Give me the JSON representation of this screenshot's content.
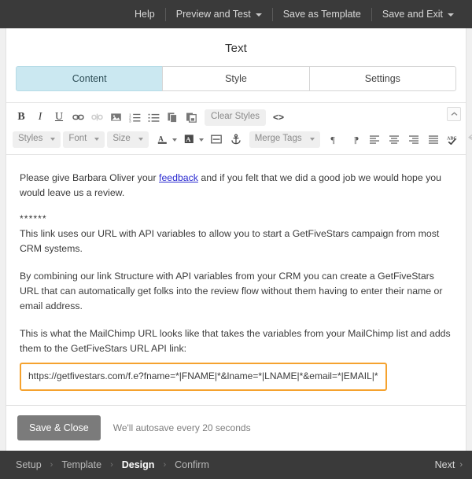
{
  "topbar": {
    "items": [
      {
        "label": "Help",
        "caret": false
      },
      {
        "label": "Preview and Test",
        "caret": true
      },
      {
        "label": "Save as Template",
        "caret": false
      },
      {
        "label": "Save and Exit",
        "caret": true
      }
    ]
  },
  "panel": {
    "title": "Text",
    "tabs": [
      {
        "label": "Content",
        "active": true
      },
      {
        "label": "Style",
        "active": false
      },
      {
        "label": "Settings",
        "active": false
      }
    ]
  },
  "toolbar": {
    "row1": [
      {
        "name": "bold",
        "glyph": "B"
      },
      {
        "name": "italic",
        "glyph": "I"
      },
      {
        "name": "underline",
        "glyph": "U"
      },
      {
        "name": "insert-link",
        "glyph": "link"
      },
      {
        "name": "unlink",
        "glyph": "unlink"
      },
      {
        "name": "insert-image",
        "glyph": "image"
      },
      {
        "name": "ordered-list",
        "glyph": "ol"
      },
      {
        "name": "unordered-list",
        "glyph": "ul"
      },
      {
        "name": "copy",
        "glyph": "copy"
      },
      {
        "name": "paste",
        "glyph": "paste"
      }
    ],
    "clear_styles_label": "Clear Styles",
    "source_code_label": "<>",
    "row2_chips": [
      {
        "name": "styles",
        "label": "Styles"
      },
      {
        "name": "font",
        "label": "Font"
      },
      {
        "name": "size",
        "label": "Size"
      }
    ],
    "merge_tags_label": "Merge Tags",
    "row2_icons": [
      {
        "name": "text-color",
        "glyph": "text-color"
      },
      {
        "name": "background-color",
        "glyph": "bg-color"
      },
      {
        "name": "horizontal-rule",
        "glyph": "hr"
      },
      {
        "name": "anchor",
        "glyph": "anchor"
      }
    ],
    "row2_tail": [
      {
        "name": "paragraph-ltr",
        "glyph": "pilcrow-ltr"
      },
      {
        "name": "paragraph-rtl",
        "glyph": "pilcrow-rtl"
      },
      {
        "name": "align-left",
        "glyph": "align-left"
      },
      {
        "name": "align-center",
        "glyph": "align-center"
      },
      {
        "name": "align-right",
        "glyph": "align-right"
      },
      {
        "name": "align-justify",
        "glyph": "align-justify"
      },
      {
        "name": "spellcheck",
        "glyph": "spellcheck"
      },
      {
        "name": "undo",
        "glyph": "undo",
        "disabled": true
      },
      {
        "name": "redo",
        "glyph": "redo",
        "disabled": true
      }
    ],
    "collapse_label": "collapse-toolbar"
  },
  "document": {
    "para1_before_link": "Please give Barbara Oliver your ",
    "para1_link": "feedback",
    "para1_after_link": " and if you felt that we did a good job we would hope you would leave us a review.",
    "divider": "******",
    "para2": "This link uses our URL with API variables to allow you to start a GetFiveStars campaign from most CRM systems.",
    "para3": "By combining our link Structure with API variables from your CRM you can create a GetFiveStars URL that can automatically get folks into the review flow without them having to enter their name or email address.",
    "para4": "This is what the MailChimp URL looks like that takes the variables from your MailChimp list and adds them to the GetFiveStars URL API link:",
    "url": "https://getfivestars.com/f.e?fname=*|FNAME|*&lname=*|LNAME|*&email=*|EMAIL|*"
  },
  "actions": {
    "save_close_label": "Save & Close",
    "autosave_text": "We'll autosave every 20 seconds"
  },
  "wizard": {
    "steps": [
      {
        "label": "Setup",
        "active": false
      },
      {
        "label": "Template",
        "active": false
      },
      {
        "label": "Design",
        "active": true
      },
      {
        "label": "Confirm",
        "active": false
      }
    ],
    "separator": "›",
    "next_label": "Next",
    "next_chevron": "›"
  },
  "colors": {
    "chrome_bar": "#3a3a3a",
    "active_tab": "#cbe8f1",
    "url_box_border": "#f5a22e",
    "link": "#2a2ad0",
    "save_button": "#7b7b7b"
  }
}
